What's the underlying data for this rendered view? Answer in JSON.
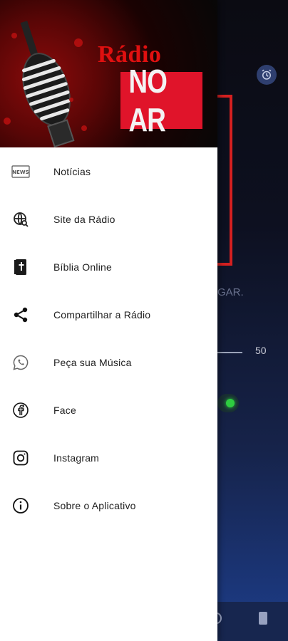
{
  "header": {
    "brand_line1": "Rádio",
    "brand_line2": "NO AR"
  },
  "menu": [
    {
      "label": "Notícias",
      "icon": "news-icon"
    },
    {
      "label": "Site da Rádio",
      "icon": "globe-search-icon"
    },
    {
      "label": "Bíblia Online",
      "icon": "bible-icon"
    },
    {
      "label": "Compartilhar a Rádio",
      "icon": "share-icon"
    },
    {
      "label": "Peça sua Música",
      "icon": "whatsapp-icon"
    },
    {
      "label": "Face",
      "icon": "facebook-icon"
    },
    {
      "label": "Instagram",
      "icon": "instagram-icon"
    },
    {
      "label": "Sobre o Aplicativo",
      "icon": "info-icon"
    }
  ],
  "background": {
    "partial_text": "GAR.",
    "volume_value": "50"
  },
  "colors": {
    "drawer_bg": "#ffffff",
    "brand_red": "#e0142a",
    "status_green": "#2ecc40"
  }
}
